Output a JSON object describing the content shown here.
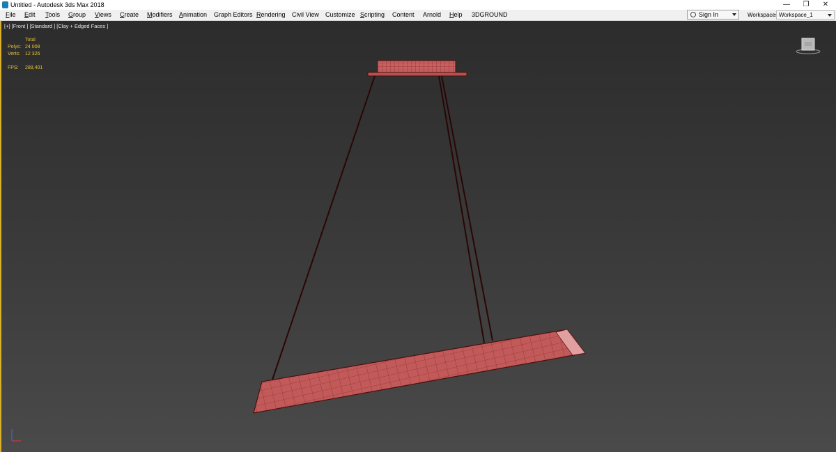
{
  "window": {
    "title": "Untitled - Autodesk 3ds Max 2018",
    "minimize": "—",
    "restore": "❐",
    "close": "✕"
  },
  "menu": [
    {
      "label": "File",
      "accel": "F",
      "rest": "ile"
    },
    {
      "label": "Edit",
      "accel": "E",
      "rest": "dit"
    },
    {
      "label": "Tools",
      "accel": "T",
      "rest": "ools"
    },
    {
      "label": "Group",
      "accel": "G",
      "rest": "roup"
    },
    {
      "label": "Views",
      "accel": "V",
      "rest": "iews"
    },
    {
      "label": "Create",
      "accel": "C",
      "rest": "reate"
    },
    {
      "label": "Modifiers",
      "accel": "M",
      "rest": "odifiers"
    },
    {
      "label": "Animation",
      "accel": "A",
      "rest": "nimation"
    },
    {
      "label": "Graph Editors",
      "accel": "",
      "rest": "Graph Editors"
    },
    {
      "label": "Rendering",
      "accel": "R",
      "rest": "endering"
    },
    {
      "label": "Civil View",
      "accel": "",
      "rest": "Civil View"
    },
    {
      "label": "Customize",
      "accel": "",
      "rest": "Customize"
    },
    {
      "label": "Scripting",
      "accel": "S",
      "rest": "cripting"
    },
    {
      "label": "Content",
      "accel": "",
      "rest": "Content"
    },
    {
      "label": "Arnold",
      "accel": "",
      "rest": "Arnold"
    },
    {
      "label": "Help",
      "accel": "H",
      "rest": "elp"
    },
    {
      "label": "3DGROUND",
      "accel": "",
      "rest": "3DGROUND"
    }
  ],
  "signin": {
    "label": "Sign In"
  },
  "workspaces": {
    "label": "Workspaces:",
    "value": "Workspace_1"
  },
  "viewport": {
    "label": "[+] [Front ] [Standard ] [Clay + Edged Faces ]",
    "stats": {
      "header": "Total",
      "polys_label": "Polys:",
      "polys_value": "24 008",
      "verts_label": "Verts:",
      "verts_value": "12 326",
      "fps_label": "FPS:",
      "fps_value": "288,401"
    }
  },
  "colors": {
    "accent_border": "#d8b02c",
    "stats_text": "#e8c232",
    "model_fill": "#c25a5a",
    "model_edge": "#5a1010"
  }
}
